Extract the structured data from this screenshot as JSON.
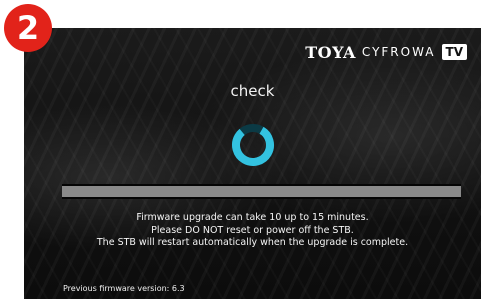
{
  "step_badge": "2",
  "logo": {
    "brand": "TOYA",
    "sub": "CYFROWA",
    "tv": "TV"
  },
  "status": "check",
  "spinner_icon": "loading-ring-icon",
  "message": {
    "line1": "Firmware upgrade can take 10 up to 15 minutes.",
    "line2": "Please  DO NOT  reset or power off the STB.",
    "line3": "The STB will restart automatically when the upgrade is complete."
  },
  "footer": {
    "previous_version": "Previous firmware version: 6.3"
  },
  "colors": {
    "badge": "#e2231a",
    "spinner": "#33c2e0",
    "background": "#111111"
  }
}
